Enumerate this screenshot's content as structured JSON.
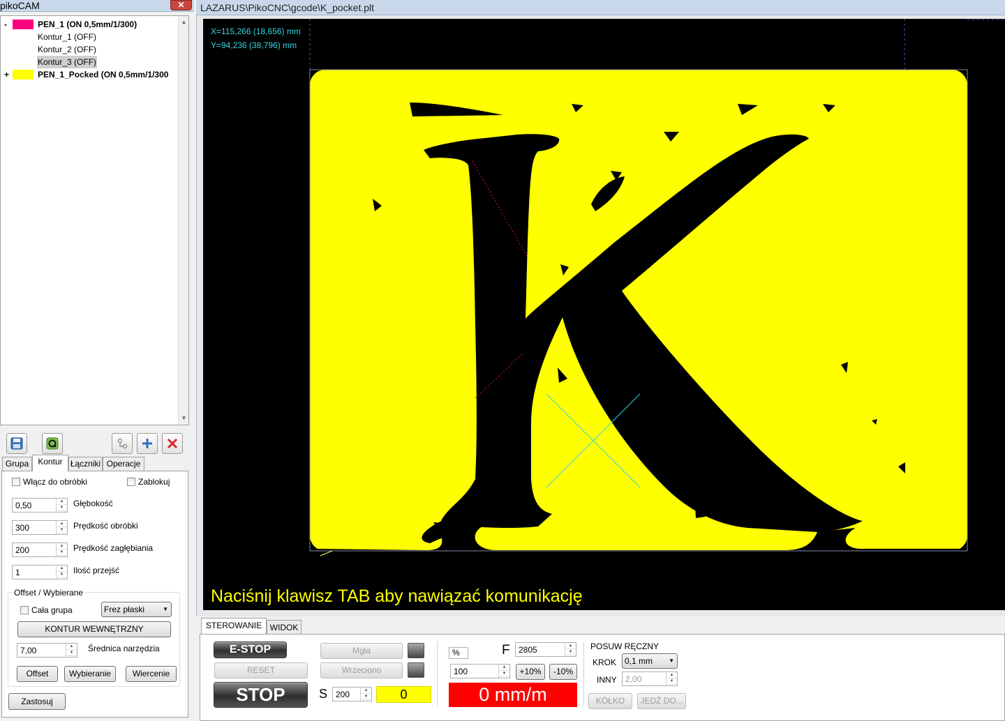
{
  "left_window": {
    "title": "pikoCAM",
    "close": "✕"
  },
  "tree": {
    "pens": [
      {
        "expander": "-",
        "color": "#ff0080",
        "label": "PEN_1 (ON 0,5mm/1/300)",
        "children": [
          "Kontur_1 (OFF)",
          "Kontur_2 (OFF)",
          "Kontur_3 (OFF)"
        ]
      },
      {
        "expander": "+",
        "color": "#ffff00",
        "label": "PEN_1_Pocked (ON 0,5mm/1/300"
      }
    ],
    "selected_child": "Kontur_3 (OFF)"
  },
  "toolbar": {
    "icons": [
      "save-icon",
      "quick-view-icon",
      "connect-icon",
      "add-icon",
      "delete-icon"
    ]
  },
  "tabs": [
    "Grupa",
    "Kontur",
    "Łączniki",
    "Operacje"
  ],
  "active_tab": "Kontur",
  "kontur": {
    "enable_label": "Włącz do obróbki",
    "lock_label": "Zablokuj",
    "depth_value": "0,50",
    "depth_label": "Głębokość",
    "speed_value": "300",
    "speed_label": "Prędkość obróbki",
    "plunge_value": "200",
    "plunge_label": "Prędkość zagłębiania",
    "passes_value": "1",
    "passes_label": "Ilość przejść",
    "offset_group_label": "Offset / Wybierane",
    "whole_group_label": "Cała grupa",
    "tool_type": "Frez płaski",
    "contour_button": "KONTUR WEWNĘTRZNY",
    "tool_diameter_value": "7,00",
    "tool_diameter_label": "Średnica narzędzia",
    "offset_button": "Offset",
    "pocket_button": "Wybieranie",
    "drill_button": "Wiercenie",
    "apply_button": "Zastosuj"
  },
  "main_window": {
    "title": "LAZARUS\\PikoCNC\\gcode\\K_pocket.plt"
  },
  "canvas": {
    "coord_x": "X=115,266 (18,656) mm",
    "coord_y": "Y=94,236 (38,796) mm",
    "message": "Naciśnij klawisz TAB aby nawiązać komunikację",
    "fill_color": "#ffff00",
    "background": "#000000",
    "cursor_color": "#35d7e0"
  },
  "control": {
    "tabs": [
      "STEROWANIE",
      "WIDOK"
    ],
    "active_tab": "STEROWANIE",
    "estop": "E-STOP",
    "reset": "RESET",
    "stop": "STOP",
    "mist": "Mgła",
    "spindle": "Wrzeciono",
    "s_label": "S",
    "s_value": "200",
    "s_display": "0",
    "percent_label": "%",
    "percent_value": "100",
    "f_label": "F",
    "f_value": "2805",
    "plus10": "+10%",
    "minus10": "-10%",
    "feed_display": "0 mm/m",
    "manual_group": "POSUW RĘCZNY",
    "step_label": "KROK",
    "step_value": "0,1 mm",
    "other_label": "INNY",
    "other_value": "2,00",
    "wheel_button": "KÓŁKO",
    "goto_button": "JEDŹ DO..."
  }
}
